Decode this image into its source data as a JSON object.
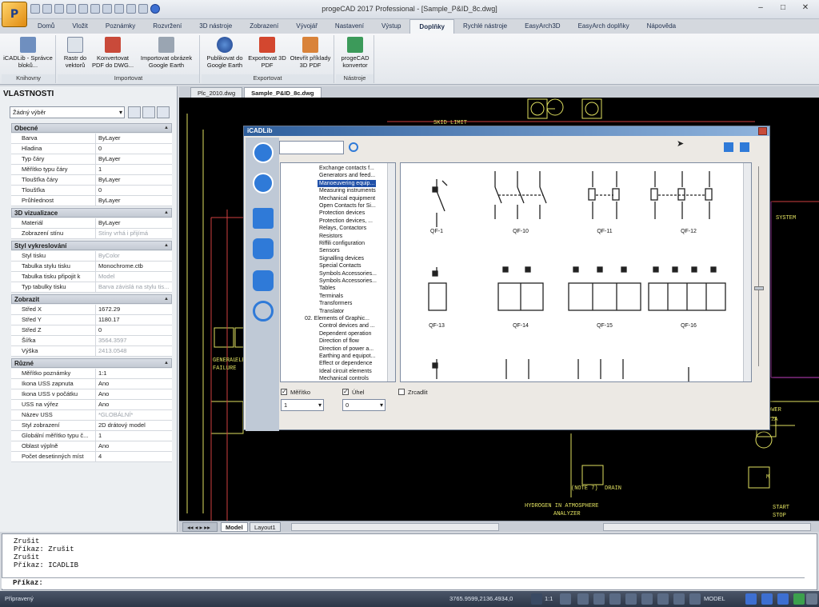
{
  "app": {
    "window_title": "progeCAD 2017 Professional - [Sample_P&ID_8c.dwg]",
    "logo": "progeCAD-logo"
  },
  "ribbon_tabs": [
    "Domů",
    "Vložit",
    "Poznámky",
    "Rozvržení",
    "3D nástroje",
    "Zobrazení",
    "Vývojář",
    "Nastavení",
    "Výstup",
    "Doplňky",
    "Rychlé nástroje",
    "EasyArch3D",
    "EasyArch doplňky",
    "Nápověda"
  ],
  "active_tab": "Doplňky",
  "ribbon": {
    "groups": [
      {
        "label": "Knihovny",
        "buttons": [
          {
            "label": "iCADLib - Správce bloků...",
            "icon": "library-icon"
          }
        ]
      },
      {
        "label": "Importovat",
        "buttons": [
          {
            "label": "Rastr do vektorů",
            "icon": "raster-vector-icon"
          },
          {
            "label": "Konvertovat PDF do DWG...",
            "icon": "pdf-dwg-icon"
          },
          {
            "label": "Importovat obrázek Google Earth",
            "icon": "google-earth-import-icon"
          }
        ]
      },
      {
        "label": "Exportovat",
        "buttons": [
          {
            "label": "Publikovat do Google Earth",
            "icon": "google-earth-icon"
          },
          {
            "label": "Exportovat 3D PDF",
            "icon": "pdf-3d-icon"
          },
          {
            "label": "Otevřít příklady 3D PDF",
            "icon": "pdf-samples-icon"
          }
        ]
      },
      {
        "label": "Nástroje",
        "buttons": [
          {
            "label": "progeCAD konvertor",
            "icon": "converter-icon"
          }
        ]
      }
    ]
  },
  "doc_tabs": [
    "Plc_2010.dwg",
    "Sample_P&ID_8c.dwg"
  ],
  "active_doc": "Sample_P&ID_8c.dwg",
  "properties": {
    "title": "VLASTNOSTI",
    "selection": "Žádný výběr",
    "sections": [
      {
        "name": "Obecné",
        "rows": [
          [
            "Barva",
            "ByLayer"
          ],
          [
            "Hladina",
            "0"
          ],
          [
            "Typ čáry",
            "ByLayer"
          ],
          [
            "Měřítko typu čáry",
            "1"
          ],
          [
            "Tloušťka čáry",
            "ByLayer"
          ],
          [
            "Tloušťka",
            "0"
          ],
          [
            "Průhlednost",
            "ByLayer"
          ]
        ]
      },
      {
        "name": "3D vizualizace",
        "rows": [
          [
            "Materiál",
            "ByLayer"
          ],
          [
            "Zobrazení stínu",
            "Stíny vrhá i přijímá"
          ]
        ]
      },
      {
        "name": "Styl vykreslování",
        "rows": [
          [
            "Styl tisku",
            "ByColor"
          ],
          [
            "Tabulka stylu tisku",
            "Monochrome.ctb"
          ],
          [
            "Tabulka tisku připojit k",
            "Model"
          ],
          [
            "Typ tabulky tisku",
            "Barva závislá na stylu tis..."
          ]
        ]
      },
      {
        "name": "Zobrazit",
        "rows": [
          [
            "Střed X",
            "1672.29"
          ],
          [
            "Střed Y",
            "1180.17"
          ],
          [
            "Střed Z",
            "0"
          ],
          [
            "Šířka",
            "3564.3597"
          ],
          [
            "Výška",
            "2413.0548"
          ]
        ]
      },
      {
        "name": "Různé",
        "rows": [
          [
            "Měřítko poznámky",
            "1:1"
          ],
          [
            "Ikona USS zapnuta",
            "Ano"
          ],
          [
            "Ikona USS v počátku",
            "Ano"
          ],
          [
            "USS na výřez",
            "Ano"
          ],
          [
            "Název USS",
            "*GLOBÁLNÍ*"
          ],
          [
            "Styl zobrazení",
            "2D drátový model"
          ],
          [
            "Globální měřítko typu č...",
            "1"
          ],
          [
            "Oblast výplně",
            "Ano"
          ],
          [
            "Počet desetinných míst",
            "4"
          ]
        ]
      }
    ]
  },
  "dialog": {
    "title": "iCADLib",
    "side_icons": [
      "back-icon",
      "check-icon",
      "folder-icon",
      "network-icon",
      "cad-icon",
      "settings-icon"
    ],
    "tree": [
      "Exchange contacts f...",
      "Generators and feed...",
      "Manoeuvering equip...",
      "Measuring instruments",
      "Mechanical equipment",
      "Open Contacts for Si...",
      "Protection devices",
      "Protection devices, ...",
      "Relays, Contactors",
      "Resistors",
      "Riffili configuration",
      "Sensors",
      "Signalling devices",
      "Special Contacts",
      "Symbols Accessories...",
      "Symbols Accessories...",
      "Tables",
      "Terminals",
      "Transformers",
      "Translator",
      "02. Elements of Graphic...",
      "Control devices and ...",
      "Dependent operation",
      "Direction of flow",
      "Direction of power a...",
      "Earthing and equipot...",
      "Effect or dependence",
      "Ideal circuit elements",
      "Mechanical controls"
    ],
    "tree_selected": "Manoeuvering equip...",
    "symbols": [
      "QF-1",
      "QF-10",
      "QF-11",
      "QF-12",
      "QF-13",
      "QF-14",
      "QF-15",
      "QF-16"
    ],
    "scale_label": "Měřítko",
    "scale_value": "1",
    "angle_label": "Úhel",
    "angle_value": "0",
    "mirror_label": "Zrcadlit"
  },
  "cad": {
    "labels": [
      "SKID LIMIT",
      "SYSTEM",
      "(NOTE 7)",
      "DRAIN",
      "HYDROGEN IN ATMOSPHERE",
      "ANALYZER",
      "START",
      "STOP",
      "OWER",
      "2A",
      "GENERAL",
      "FAILURE",
      "ELEC",
      "M"
    ],
    "layout_tabs": [
      "Model",
      "Layout1"
    ]
  },
  "command": {
    "history": [
      "Zrušit",
      "Příkaz: Zrušit",
      "Zrušit",
      "Příkaz: ICADLIB"
    ],
    "prompt": "Příkaz:"
  },
  "status": {
    "ready": "Připravený",
    "coords": "3765.9599,2136.4934,0",
    "scale": "1:1",
    "model": "MODEL"
  }
}
